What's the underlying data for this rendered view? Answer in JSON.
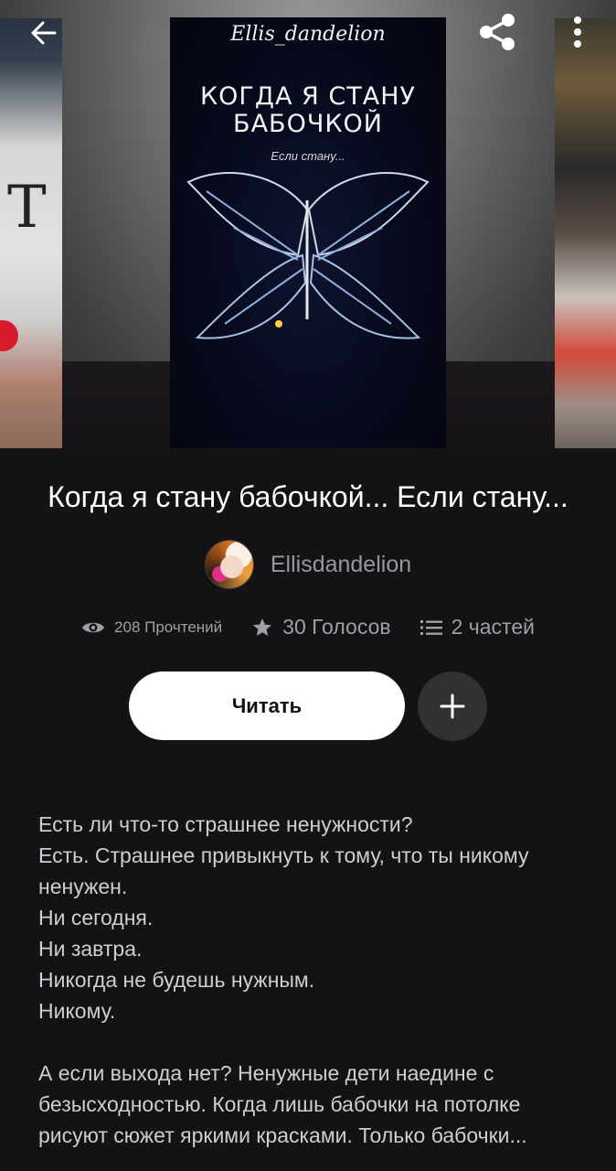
{
  "header": {
    "back_icon": "arrow-left-icon",
    "share_icon": "share-icon",
    "more_icon": "more-vertical-icon"
  },
  "cover": {
    "author": "Ellis_dandelion",
    "title_line1": "КОГДА Я СТАНУ",
    "title_line2": "БАБОЧКОЙ",
    "subtitle": "Если стану..."
  },
  "story": {
    "title": "Когда я стану бабочкой... Если  стану...",
    "author": "Ellisdandelion"
  },
  "stats": {
    "reads": "208 Прочтений",
    "votes": "30 Голосов",
    "parts": "2 частей"
  },
  "actions": {
    "read_label": "Читать",
    "add_icon": "plus-icon"
  },
  "description": {
    "lines": [
      "Есть ли что-то страшнее ненужности?",
      "Есть. Страшнее привыкнуть к тому, что ты никому ненужен.",
      "Ни сегодня.",
      "Ни завтра.",
      "Никогда не будешь нужным.",
      "Никому."
    ],
    "paragraph2": "А если выхода нет? Ненужные дети наедине с безысходностью. Когда лишь бабочки на потолке рисуют сюжет яркими красками. Только бабочки..."
  },
  "colors": {
    "background": "#151216",
    "muted_text": "#a19fa3",
    "button_bg": "#ffffff",
    "add_button_bg": "#333034"
  }
}
